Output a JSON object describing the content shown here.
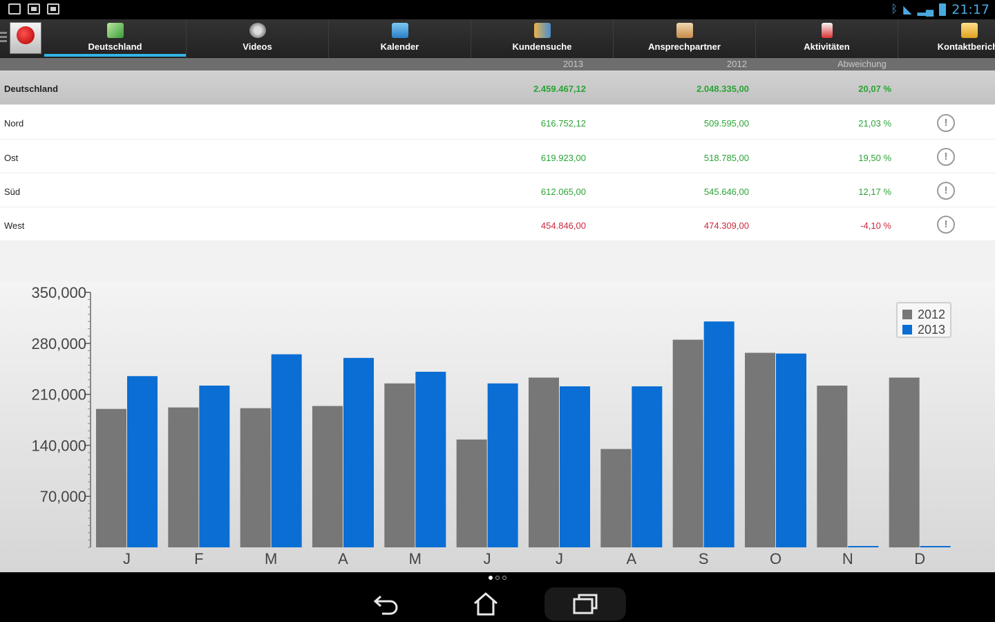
{
  "status_bar": {
    "time": "21:17",
    "colors": {
      "icons": "#4aa8e0"
    }
  },
  "tabs": [
    {
      "label": "Deutschland",
      "icon": "chart-icon",
      "active": true
    },
    {
      "label": "Videos",
      "icon": "video-reel-icon",
      "active": false
    },
    {
      "label": "Kalender",
      "icon": "calendar-icon",
      "active": false
    },
    {
      "label": "Kundensuche",
      "icon": "people-search-icon",
      "active": false
    },
    {
      "label": "Ansprechpartner",
      "icon": "contact-card-icon",
      "active": false
    },
    {
      "label": "Aktivitäten",
      "icon": "clipboard-icon",
      "active": false
    },
    {
      "label": "Kontaktbericht",
      "icon": "report-icon",
      "active": false
    }
  ],
  "table": {
    "headers": {
      "col1": "2013",
      "col2": "2012",
      "col3": "Abweichung"
    },
    "total": {
      "name": "Deutschland",
      "v2013": "2.459.467,12",
      "v2012": "2.048.335,00",
      "diff": "20,07 %",
      "status": "positive"
    },
    "rows": [
      {
        "name": "Nord",
        "v2013": "616.752,12",
        "v2012": "509.595,00",
        "diff": "21,03 %",
        "status": "positive"
      },
      {
        "name": "Ost",
        "v2013": "619.923,00",
        "v2012": "518.785,00",
        "diff": "19,50 %",
        "status": "positive"
      },
      {
        "name": "Süd",
        "v2013": "612.065,00",
        "v2012": "545.646,00",
        "diff": "12,17 %",
        "status": "positive"
      },
      {
        "name": "West",
        "v2013": "454.846,00",
        "v2012": "474.309,00",
        "diff": "-4,10 %",
        "status": "negative"
      }
    ],
    "colors": {
      "positive": "#2aa336",
      "negative": "#c8283c"
    }
  },
  "chart_data": {
    "type": "bar",
    "categories": [
      "J",
      "F",
      "M",
      "A",
      "M",
      "J",
      "J",
      "A",
      "S",
      "O",
      "N",
      "D"
    ],
    "series": [
      {
        "name": "2012",
        "color": "#777777",
        "values": [
          190000,
          192000,
          191000,
          194000,
          225000,
          148000,
          233000,
          135000,
          285000,
          267000,
          222000,
          233000
        ]
      },
      {
        "name": "2013",
        "color": "#0a6ed4",
        "values": [
          235000,
          222000,
          265000,
          260000,
          241000,
          225000,
          221000,
          221000,
          310000,
          266000,
          0,
          0
        ]
      }
    ],
    "yticks": [
      "350,000",
      "280,000",
      "210,000",
      "140,000",
      "70,000"
    ],
    "ytick_values": [
      350000,
      280000,
      210000,
      140000,
      70000
    ],
    "ylim": [
      0,
      350000
    ],
    "legend": "top-right",
    "grid": false
  },
  "pager": {
    "pages": 3,
    "current": 0
  }
}
